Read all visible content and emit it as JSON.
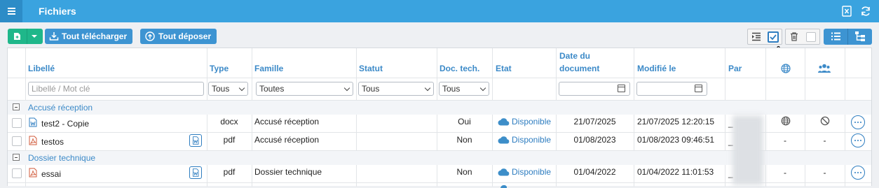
{
  "header": {
    "title": "Fichiers"
  },
  "toolbar": {
    "download_all_label": "Tout télécharger",
    "upload_all_label": "Tout déposer"
  },
  "table": {
    "columns": {
      "libelle": "Libellé",
      "type": "Type",
      "famille": "Famille",
      "statut": "Statut",
      "doc_tech": "Doc. tech.",
      "etat": "Etat",
      "date_doc_line1": "Date du",
      "date_doc_line2": "document",
      "modifie": "Modifié le",
      "par": "Par"
    },
    "filters": {
      "libelle_placeholder": "Libellé / Mot clé",
      "type": "Tous",
      "famille": "Toutes",
      "statut": "Tous",
      "doc_tech": "Tous"
    },
    "groups": [
      {
        "label": "Accusé réception",
        "rows": [
          {
            "name": "test2 - Copie",
            "file_icon": "word-file-icon",
            "type": "docx",
            "famille": "Accusé réception",
            "statut": "",
            "doc_tech": "Oui",
            "etat": "Disponible",
            "date_doc": "21/07/2025",
            "modifie": "21/07/2025 12:20:15",
            "par": "_",
            "col_globe": "globe-icon",
            "col_people": "forbidden-icon"
          },
          {
            "name": "testos",
            "file_icon": "pdf-file-icon",
            "type": "pdf",
            "famille": "Accusé réception",
            "statut": "",
            "doc_tech": "Non",
            "etat": "Disponible",
            "date_doc": "01/08/2023",
            "modifie": "01/08/2023 09:46:51",
            "par": "_",
            "col_globe": "-",
            "col_people": "-"
          }
        ]
      },
      {
        "label": "Dossier technique",
        "rows": [
          {
            "name": "essai",
            "file_icon": "pdf-file-icon",
            "type": "pdf",
            "famille": "Dossier technique",
            "statut": "",
            "doc_tech": "Non",
            "etat": "Disponible",
            "date_doc": "01/04/2022",
            "modifie": "01/04/2022 11:01:53",
            "par": "_",
            "col_globe": "-",
            "col_people": "-"
          }
        ]
      }
    ]
  },
  "colors": {
    "header": "#3aa3df",
    "accent": "#3d94d2",
    "green": "#1fb78a",
    "cloud": "#3d8ec9"
  }
}
